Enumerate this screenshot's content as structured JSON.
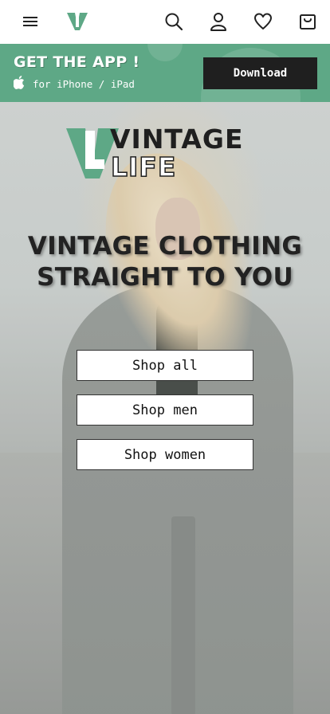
{
  "header": {
    "menu_icon": "hamburger-icon",
    "logo_icon": "vintage-v-logo-icon",
    "search_icon": "search-icon",
    "account_icon": "user-icon",
    "wishlist_icon": "heart-icon",
    "cart_icon": "shopping-bag-icon"
  },
  "app_banner": {
    "title": "GET THE APP !",
    "subtitle": "for iPhone / iPad",
    "platform_icon": "apple-icon",
    "download_label": "Download",
    "background_color": "#5ea886"
  },
  "hero": {
    "logo_top": "VINTAGE",
    "logo_bottom": "LIFE",
    "headline_line1": "VINTAGE CLOTHING",
    "headline_line2": "STRAIGHT TO YOU",
    "buttons": [
      {
        "label": "Shop all"
      },
      {
        "label": "Shop men"
      },
      {
        "label": "Shop women"
      }
    ]
  },
  "colors": {
    "brand_green": "#5ea886",
    "dark": "#1f1f1f"
  }
}
